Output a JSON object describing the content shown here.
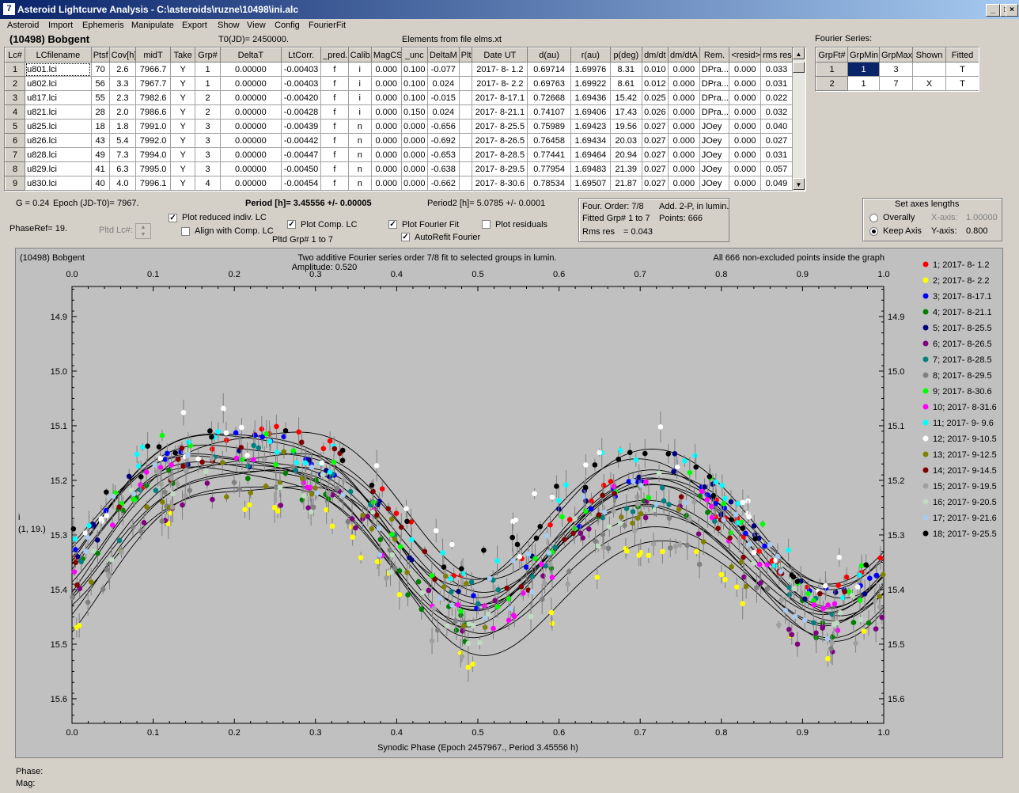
{
  "window": {
    "title": "Asteroid Lightcurve Analysis - C:\\asteroids\\ruzne\\10498\\ini.alc",
    "min": "_",
    "max": "□",
    "close": "×"
  },
  "menu": [
    "Asteroid",
    "Import",
    "Ephemeris",
    "Manipulate",
    "Export",
    "Show",
    "View",
    "Config",
    "FourierFit"
  ],
  "header": {
    "asteroid": "(10498) Bobgent",
    "t0": "T0(JD)= 2450000.",
    "elements": "Elements from file elms.xt",
    "fourier_label": "Fourier Series:"
  },
  "lc_table": {
    "columns": [
      "Lc#",
      "LCfilename",
      "Ptsf",
      "Cov[h]",
      "midT",
      "Take",
      "Grp#",
      "DeltaT",
      "LtCorr.",
      "_pred.",
      "Calib.",
      "MagCS",
      "_unc",
      "DeltaM",
      "Plt",
      "Date UT",
      "d(au)",
      "r(au)",
      "p(deg)",
      "dm/dt",
      "dm/dtA",
      "Rem.",
      "<resid>",
      "rms res"
    ],
    "rows": [
      [
        "1",
        "u801.lci",
        "70",
        "2.6",
        "7966.7",
        "Y",
        "1",
        "0.00000",
        "-0.00403",
        "f",
        "i",
        "0.000",
        "0.100",
        "-0.077",
        "",
        "2017- 8- 1.2",
        "0.69714",
        "1.69976",
        "8.31",
        "0.010",
        "0.000",
        "DPra...",
        "0.000",
        "0.033"
      ],
      [
        "2",
        "u802.lci",
        "56",
        "3.3",
        "7967.7",
        "Y",
        "1",
        "0.00000",
        "-0.00403",
        "f",
        "i",
        "0.000",
        "0.100",
        "0.024",
        "",
        "2017- 8- 2.2",
        "0.69763",
        "1.69922",
        "8.61",
        "0.012",
        "0.000",
        "DPra...",
        "0.000",
        "0.031"
      ],
      [
        "3",
        "u817.lci",
        "55",
        "2.3",
        "7982.6",
        "Y",
        "2",
        "0.00000",
        "-0.00420",
        "f",
        "i",
        "0.000",
        "0.100",
        "-0.015",
        "",
        "2017- 8-17.1",
        "0.72668",
        "1.69436",
        "15.42",
        "0.025",
        "0.000",
        "DPra...",
        "0.000",
        "0.022"
      ],
      [
        "4",
        "u821.lci",
        "28",
        "2.0",
        "7986.6",
        "Y",
        "2",
        "0.00000",
        "-0.00428",
        "f",
        "i",
        "0.000",
        "0.150",
        "0.024",
        "",
        "2017- 8-21.1",
        "0.74107",
        "1.69406",
        "17.43",
        "0.026",
        "0.000",
        "DPra...",
        "0.000",
        "0.032"
      ],
      [
        "5",
        "u825.lci",
        "18",
        "1.8",
        "7991.0",
        "Y",
        "3",
        "0.00000",
        "-0.00439",
        "f",
        "n",
        "0.000",
        "0.000",
        "-0.656",
        "",
        "2017- 8-25.5",
        "0.75989",
        "1.69423",
        "19.56",
        "0.027",
        "0.000",
        "JOey",
        "0.000",
        "0.040"
      ],
      [
        "6",
        "u826.lci",
        "43",
        "5.4",
        "7992.0",
        "Y",
        "3",
        "0.00000",
        "-0.00442",
        "f",
        "n",
        "0.000",
        "0.000",
        "-0.692",
        "",
        "2017- 8-26.5",
        "0.76458",
        "1.69434",
        "20.03",
        "0.027",
        "0.000",
        "JOey",
        "0.000",
        "0.027"
      ],
      [
        "7",
        "u828.lci",
        "49",
        "7.3",
        "7994.0",
        "Y",
        "3",
        "0.00000",
        "-0.00447",
        "f",
        "n",
        "0.000",
        "0.000",
        "-0.653",
        "",
        "2017- 8-28.5",
        "0.77441",
        "1.69464",
        "20.94",
        "0.027",
        "0.000",
        "JOey",
        "0.000",
        "0.031"
      ],
      [
        "8",
        "u829.lci",
        "41",
        "6.3",
        "7995.0",
        "Y",
        "3",
        "0.00000",
        "-0.00450",
        "f",
        "n",
        "0.000",
        "0.000",
        "-0.638",
        "",
        "2017- 8-29.5",
        "0.77954",
        "1.69483",
        "21.39",
        "0.027",
        "0.000",
        "JOey",
        "0.000",
        "0.057"
      ],
      [
        "9",
        "u830.lci",
        "40",
        "4.0",
        "7996.1",
        "Y",
        "4",
        "0.00000",
        "-0.00454",
        "f",
        "n",
        "0.000",
        "0.000",
        "-0.662",
        "",
        "2017- 8-30.6",
        "0.78534",
        "1.69507",
        "21.87",
        "0.027",
        "0.000",
        "JOey",
        "0.000",
        "0.049"
      ]
    ]
  },
  "fourier_table": {
    "columns": [
      "GrpFt#",
      "GrpMin",
      "GrpMax",
      "Shown",
      "Fitted"
    ],
    "rows": [
      [
        "1",
        "1",
        "3",
        "",
        "T"
      ],
      [
        "2",
        "1",
        "7",
        "X",
        "T"
      ]
    ]
  },
  "controls": {
    "g": "G = 0.24",
    "epoch": "Epoch (JD-T0)= 7967.",
    "period": "Period [h]= 3.45556 +/- 0.00005",
    "period2": "Period2 [h]= 5.0785 +/- 0.0001",
    "phaseref": "PhaseRef= 19.",
    "pltd_lc": "Pltd Lc#:",
    "plot_reduced": "Plot reduced indiv. LC",
    "align": "Align with Comp. LC",
    "plot_comp": "Plot Comp. LC",
    "pltd_grp": "Pltd Grp#  1  to  7",
    "plot_fourier": "Plot Fourier Fit",
    "autorefit": "AutoRefit Fourier",
    "plot_residuals": "Plot residuals",
    "info1": "Four. Order:  7/8",
    "info2": "Add. 2-P, in lumin.",
    "info3": "Fitted Grp# 1 to 7",
    "info4": "Points: 666",
    "info5": "Rms res",
    "info6": "= 0.043",
    "axes_title": "Set axes lengths",
    "overally": "Overally",
    "keep_axis": "Keep Axis",
    "xaxis_label": "X-axis:",
    "xaxis_val": "1.00000",
    "yaxis_label": "Y-axis:",
    "yaxis_val": "0.800"
  },
  "chart_data": {
    "type": "scatter",
    "title": "Two additive Fourier series order 7/8 fit to selected groups in lumin.",
    "subtitle": "Amplitude: 0.520",
    "top_left": "(10498) Bobgent",
    "top_right": "All 666 non-excluded points inside the graph",
    "xlabel": "Synodic Phase (Epoch 2457967., Period 3.45556 h)",
    "ylabel": [
      "i",
      "(1, 19.)"
    ],
    "xlim": [
      0,
      1
    ],
    "ylim": [
      14.845,
      15.645
    ],
    "y_inverted": true,
    "xticks": [
      "0.0",
      "0.1",
      "0.2",
      "0.3",
      "0.4",
      "0.5",
      "0.6",
      "0.7",
      "0.8",
      "0.9",
      "1.0"
    ],
    "yticks": [
      "14.9",
      "15.0",
      "15.1",
      "15.2",
      "15.3",
      "15.4",
      "15.5",
      "15.6"
    ],
    "ytick_values": [
      14.9,
      15.0,
      15.1,
      15.2,
      15.3,
      15.4,
      15.5,
      15.6
    ],
    "series": [
      {
        "name": "1; 2017- 8- 1.2",
        "color": "#ff0000",
        "offset": -0.02,
        "noise": 0.02
      },
      {
        "name": "2; 2017- 8- 2.2",
        "color": "#ffff00",
        "offset": 0.12,
        "noise": 0.02
      },
      {
        "name": "3; 2017- 8-17.1",
        "color": "#0000ff",
        "offset": 0.0,
        "noise": 0.02
      },
      {
        "name": "4; 2017- 8-21.1",
        "color": "#008000",
        "offset": 0.05,
        "noise": 0.03
      },
      {
        "name": "5; 2017- 8-25.5",
        "color": "#000080",
        "offset": -0.01,
        "noise": 0.03
      },
      {
        "name": "6; 2017- 8-26.5",
        "color": "#800080",
        "offset": 0.06,
        "noise": 0.03
      },
      {
        "name": "7; 2017- 8-28.5",
        "color": "#008080",
        "offset": 0.02,
        "noise": 0.03
      },
      {
        "name": "8; 2017- 8-29.5",
        "color": "#808080",
        "offset": 0.08,
        "noise": 0.04
      },
      {
        "name": "9; 2017- 8-30.6",
        "color": "#00ff00",
        "offset": 0.0,
        "noise": 0.04
      },
      {
        "name": "10; 2017- 8-31.6",
        "color": "#ff00ff",
        "offset": 0.03,
        "noise": 0.04
      },
      {
        "name": "11; 2017- 9- 9.6",
        "color": "#00ffff",
        "offset": -0.03,
        "noise": 0.03
      },
      {
        "name": "12; 2017- 9-10.5",
        "color": "#ffffff",
        "offset": -0.05,
        "noise": 0.05
      },
      {
        "name": "13; 2017- 9-12.5",
        "color": "#808000",
        "offset": 0.04,
        "noise": 0.04
      },
      {
        "name": "14; 2017- 9-14.5",
        "color": "#800000",
        "offset": 0.01,
        "noise": 0.03
      },
      {
        "name": "15; 2017- 9-19.5",
        "color": "#a0a0a0",
        "offset": 0.07,
        "noise": 0.05
      },
      {
        "name": "16; 2017- 9-20.5",
        "color": "#c0dcc0",
        "offset": 0.05,
        "noise": 0.05
      },
      {
        "name": "17; 2017- 9-21.6",
        "color": "#a6caf0",
        "offset": 0.02,
        "noise": 0.05
      },
      {
        "name": "18; 2017- 9-25.5",
        "color": "#000000",
        "offset": -0.04,
        "noise": 0.03
      }
    ]
  },
  "status": {
    "phase": "Phase:",
    "mag": "Mag:"
  }
}
